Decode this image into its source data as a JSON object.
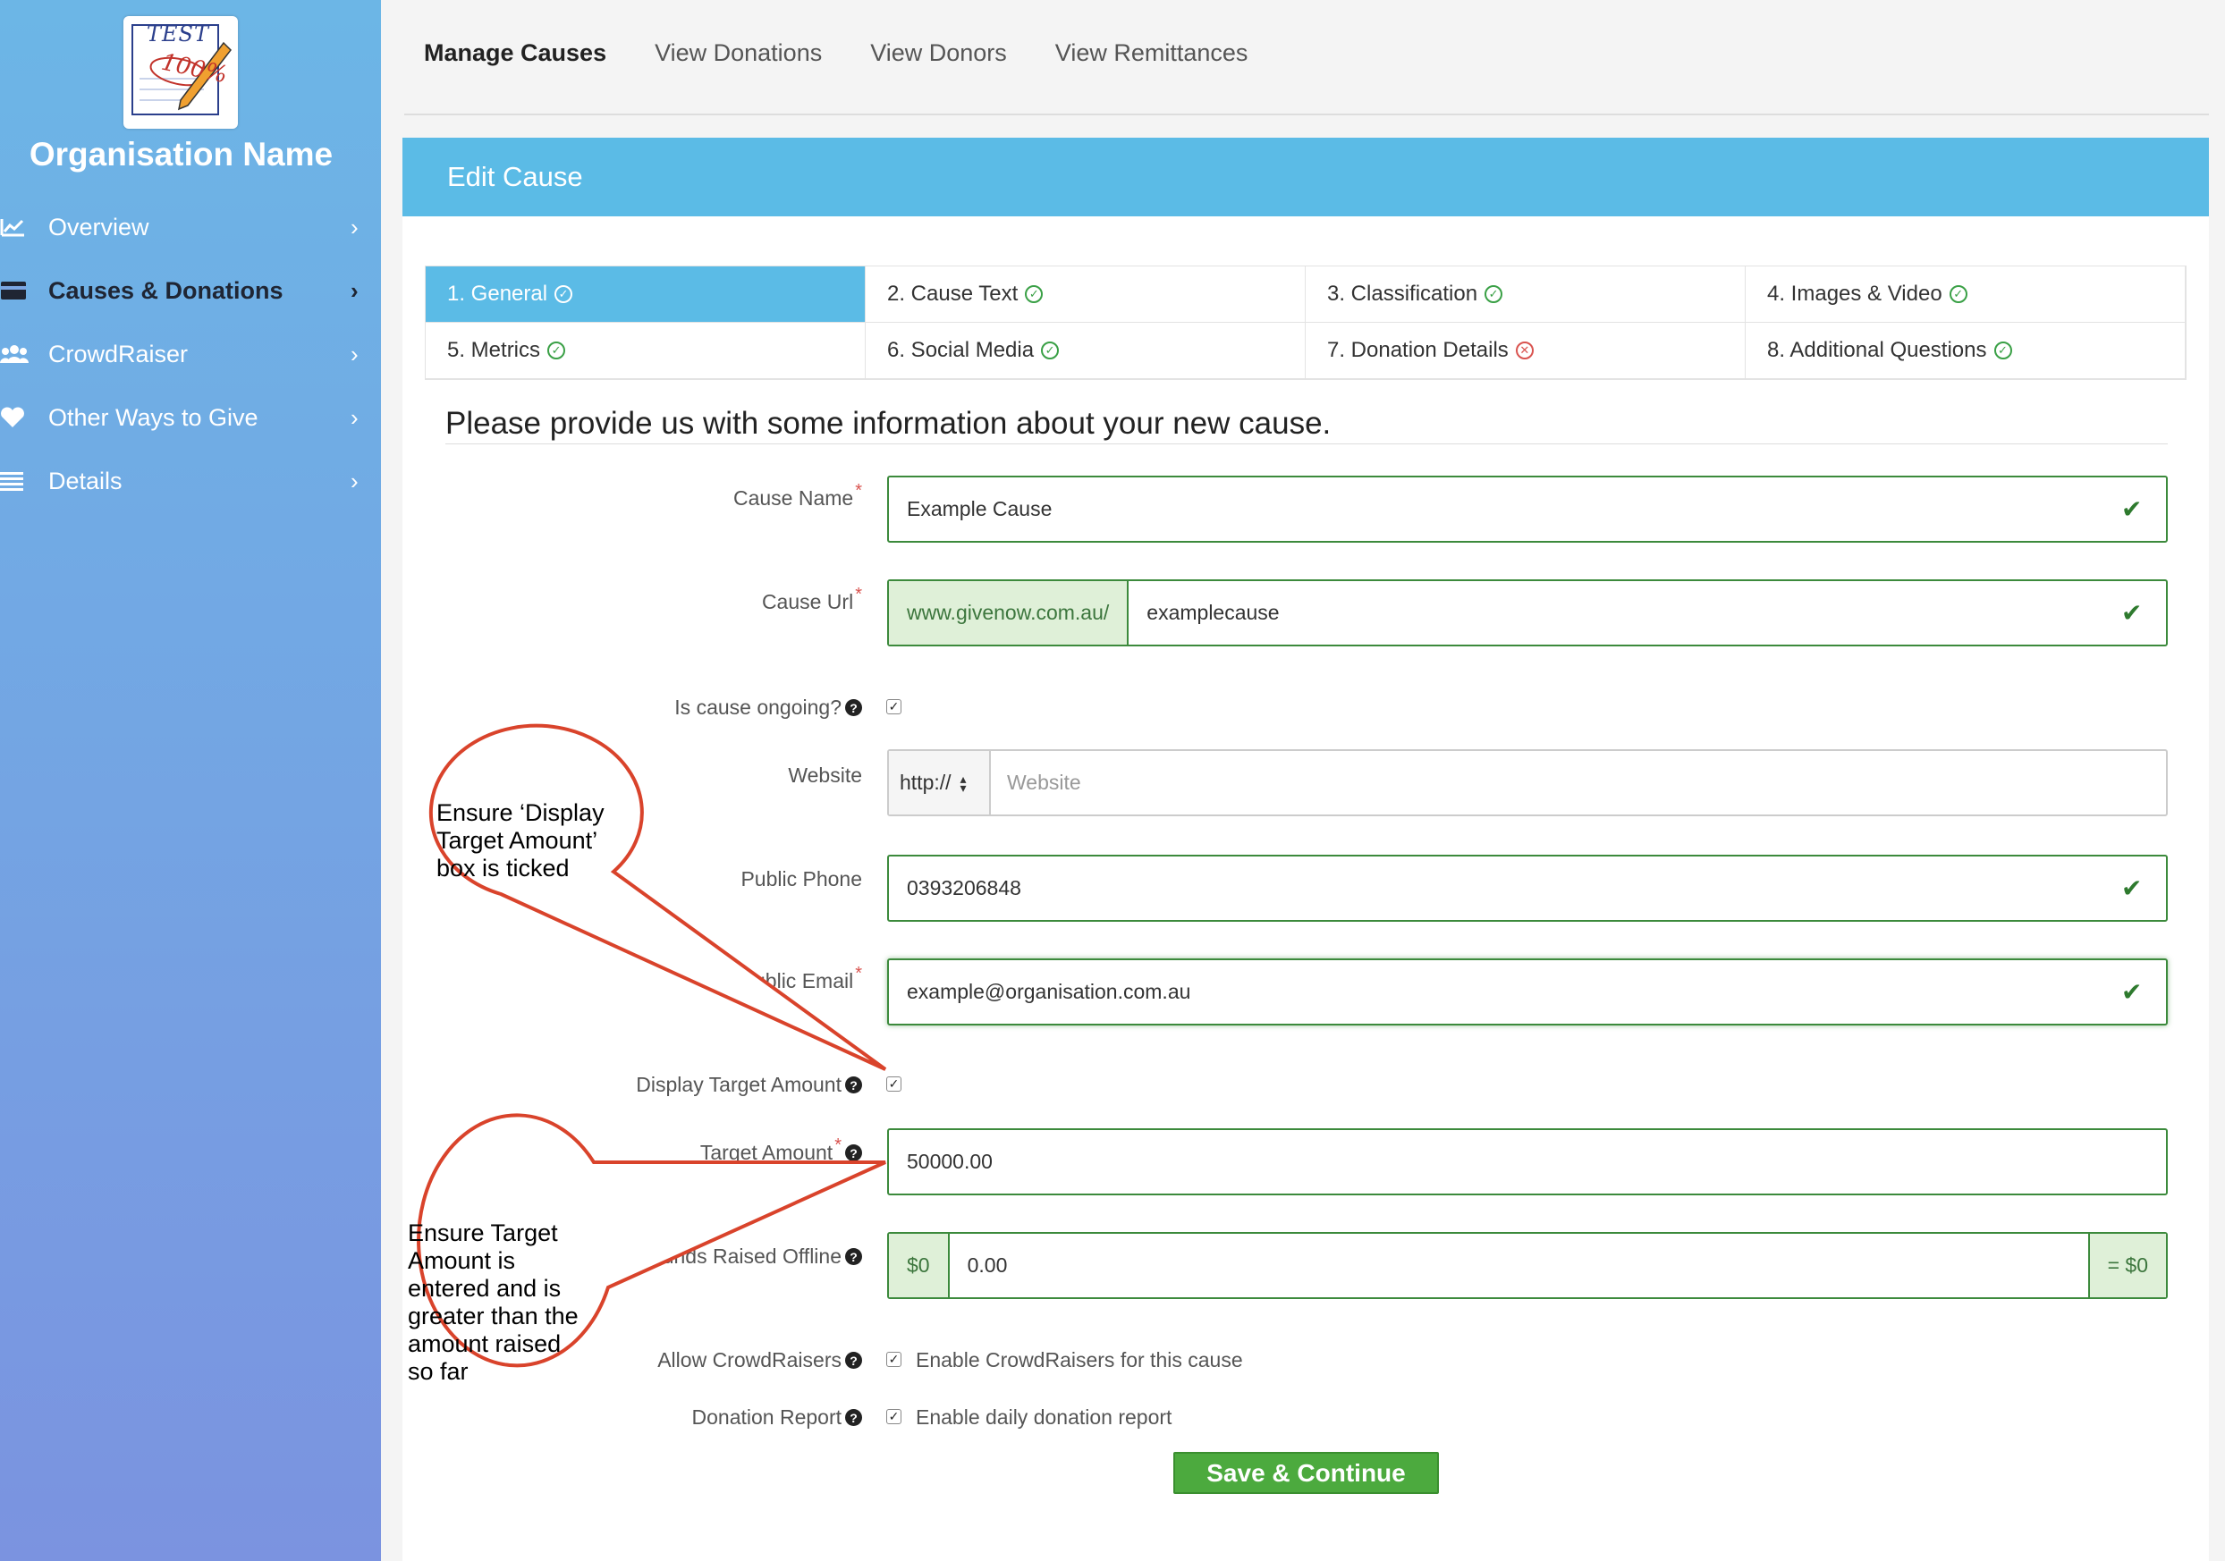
{
  "sidebar": {
    "logo": {
      "text_top": "TEST",
      "text_score": "100%"
    },
    "org_name": "Organisation Name",
    "items": [
      {
        "label": "Overview",
        "icon": "chart-icon"
      },
      {
        "label": "Causes & Donations",
        "icon": "card-icon",
        "active": true
      },
      {
        "label": "CrowdRaiser",
        "icon": "users-icon"
      },
      {
        "label": "Other Ways to Give",
        "icon": "heart-icon"
      },
      {
        "label": "Details",
        "icon": "list-icon"
      }
    ]
  },
  "topnav": {
    "tabs": [
      "Manage Causes",
      "View Donations",
      "View Donors",
      "View Remittances"
    ]
  },
  "panel": {
    "title": "Edit Cause",
    "steps": [
      {
        "label": "1. General",
        "status": "ok"
      },
      {
        "label": "2. Cause Text",
        "status": "ok"
      },
      {
        "label": "3. Classification",
        "status": "ok"
      },
      {
        "label": "4. Images & Video",
        "status": "ok"
      },
      {
        "label": "5. Metrics",
        "status": "ok"
      },
      {
        "label": "6. Social Media",
        "status": "ok"
      },
      {
        "label": "7. Donation Details",
        "status": "error"
      },
      {
        "label": "8. Additional Questions",
        "status": "ok"
      }
    ],
    "intro": "Please provide us with some information about your new cause."
  },
  "form": {
    "cause_name": {
      "label": "Cause Name",
      "value": "Example Cause"
    },
    "cause_url": {
      "label": "Cause Url",
      "prefix": "www.givenow.com.au/",
      "value": "examplecause"
    },
    "ongoing": {
      "label": "Is cause ongoing?",
      "checked": true
    },
    "website": {
      "label": "Website",
      "protocol": "http://",
      "placeholder": "Website"
    },
    "phone": {
      "label": "Public Phone",
      "value": "0393206848"
    },
    "email": {
      "label": "Public Email",
      "value": "example@organisation.com.au"
    },
    "display_target": {
      "label": "Display Target Amount",
      "checked": true
    },
    "target_amount": {
      "label": "Target Amount",
      "value": "50000.00"
    },
    "funds_offline": {
      "label": "Funds Raised Offline",
      "prefix": "$0",
      "value": "0.00",
      "suffix": "= $0"
    },
    "crowdraisers": {
      "label": "Allow CrowdRaisers",
      "text": "Enable CrowdRaisers for this cause",
      "checked": true
    },
    "donation_report": {
      "label": "Donation Report",
      "text": "Enable daily donation report",
      "checked": true
    },
    "save_label": "Save & Continue"
  },
  "annotations": {
    "callout1": [
      "Ensure ‘Display",
      "Target Amount’",
      "box is ticked"
    ],
    "callout2": [
      "Ensure Target",
      "Amount is",
      "entered and is",
      "greater than the",
      "amount raised",
      "so far"
    ]
  },
  "colors": {
    "accent": "#5bbbe6",
    "success": "#3c8a3c",
    "save": "#4caa3e",
    "annotation": "#d9432b"
  }
}
